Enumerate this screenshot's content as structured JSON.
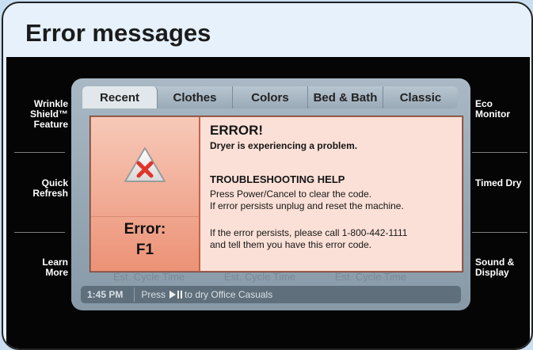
{
  "frame": {
    "title": "Error messages"
  },
  "side": {
    "left": [
      "Wrinkle Shield™ Feature",
      "Quick Refresh",
      "Learn More"
    ],
    "right": [
      "Eco Monitor",
      "Timed Dry",
      "Sound & Display"
    ]
  },
  "tabs": [
    "Recent",
    "Clothes",
    "Colors",
    "Bed & Bath",
    "Classic"
  ],
  "active_tab": "Recent",
  "est_cycle": [
    "Est. Cycle Time",
    "Est. Cycle Time",
    "Est. Cycle Time"
  ],
  "status": {
    "time": "1:45 PM",
    "hint_prefix": "Press",
    "hint_suffix": "to dry Office Casuals"
  },
  "dialog": {
    "title": "ERROR!",
    "subtitle": "Dryer is experiencing a problem.",
    "help_title": "TROUBLESHOOTING HELP",
    "help_line1": "Press Power/Cancel to clear the code.",
    "help_line2": "If error persists unplug and reset the machine.",
    "persist_line1": "If the error persists, please call 1-800-442-1111",
    "persist_line2": "and tell them you have this error code.",
    "code_label": "Error:",
    "code": "F1"
  },
  "colors": {
    "accent": "#ec9276",
    "warning_x": "#e0352b"
  },
  "icons": {
    "warning": "warning-triangle-icon",
    "play_pause": "play-pause-icon"
  }
}
